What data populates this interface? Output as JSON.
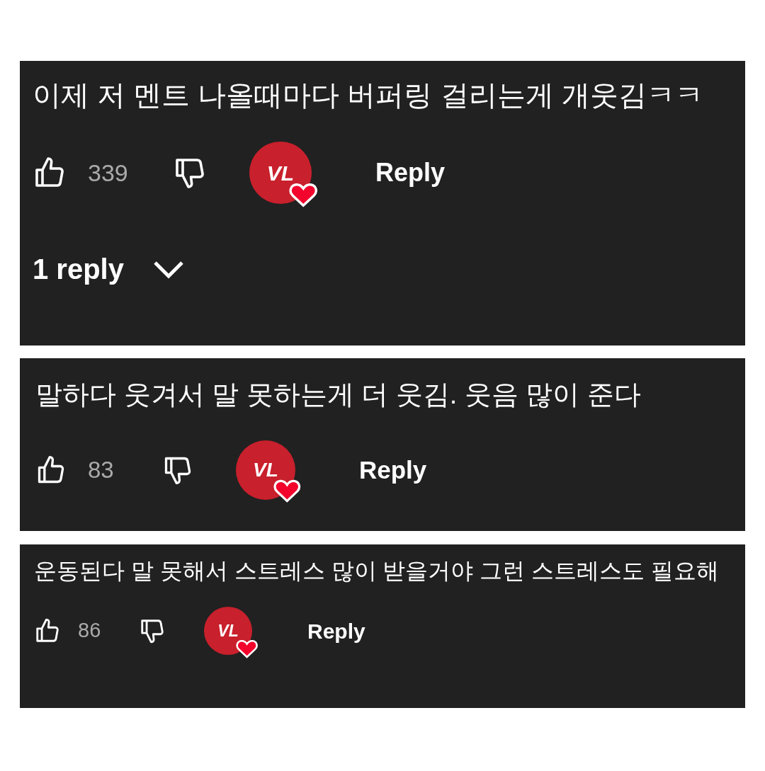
{
  "comments": [
    {
      "text": "이제 저 멘트 나올때마다 버퍼링 걸리는게 개웃김ㅋㅋ",
      "likes": "339",
      "hearted": true,
      "avatar_text": "VL",
      "reply": "Reply",
      "replies": "1 reply"
    },
    {
      "text": "말하다 웃겨서 말 못하는게 더 웃김. 웃음 많이 준다",
      "likes": "83",
      "hearted": true,
      "avatar_text": "VL",
      "reply": "Reply"
    },
    {
      "text": "운동된다 말 못해서 스트레스 많이 받을거야 그런 스트레스도 필요해",
      "likes": "86",
      "hearted": true,
      "avatar_text": "VL",
      "reply": "Reply"
    }
  ]
}
